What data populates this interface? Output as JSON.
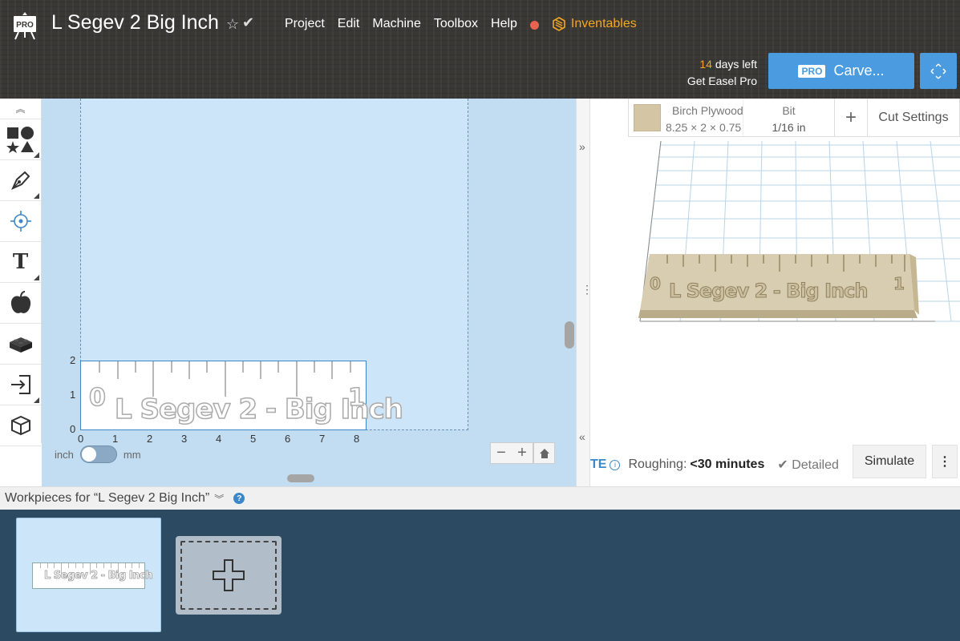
{
  "header": {
    "logo_badge": "PRO",
    "doc_title": "L Segev 2 Big Inch",
    "menu": [
      "Project",
      "Edit",
      "Machine",
      "Toolbox",
      "Help"
    ],
    "inventables_label": "Inventables",
    "trial_days": "14",
    "trial_days_suffix": "days left",
    "trial_cta": "Get Easel Pro",
    "carve_badge": "PRO",
    "carve_label": "Carve..."
  },
  "canvas": {
    "workpiece_text": "L Segev 2 - Big Inch",
    "workpiece_zero": "0",
    "workpiece_one": "1",
    "x_ticks": [
      "0",
      "1",
      "2",
      "3",
      "4",
      "5",
      "6",
      "7",
      "8"
    ],
    "y_ticks": [
      "2",
      "1",
      "0"
    ],
    "units_left": "inch",
    "units_right": "mm",
    "units_selected": "inch"
  },
  "preview": {
    "material_name": "Birch Plywood",
    "material_size": "8.25 × 2 × 0.75",
    "bit_label": "Bit",
    "bit_value": "1/16 in",
    "cut_settings_label": "Cut Settings",
    "model_text": "L Segev 2 - Big Inch",
    "model_zero": "0",
    "model_one": "1",
    "estimate_label": "TE",
    "roughing_label": "Roughing:",
    "roughing_value": "<30 minutes",
    "detailed_label": "Detailed",
    "simulate_label": "Simulate"
  },
  "workpieces": {
    "header": "Workpieces for “L Segev 2 Big Inch”",
    "thumb_text": "L Segev 2 - Big Inch"
  },
  "colors": {
    "accent": "#4a9be0",
    "header_bg": "#3a3835",
    "canvas_bg": "#c2ddf1",
    "trial_orange": "#f5a623",
    "help_dot": "#e9634f",
    "wood": "#d4c6a4",
    "tray_bg": "#2d4a63"
  }
}
